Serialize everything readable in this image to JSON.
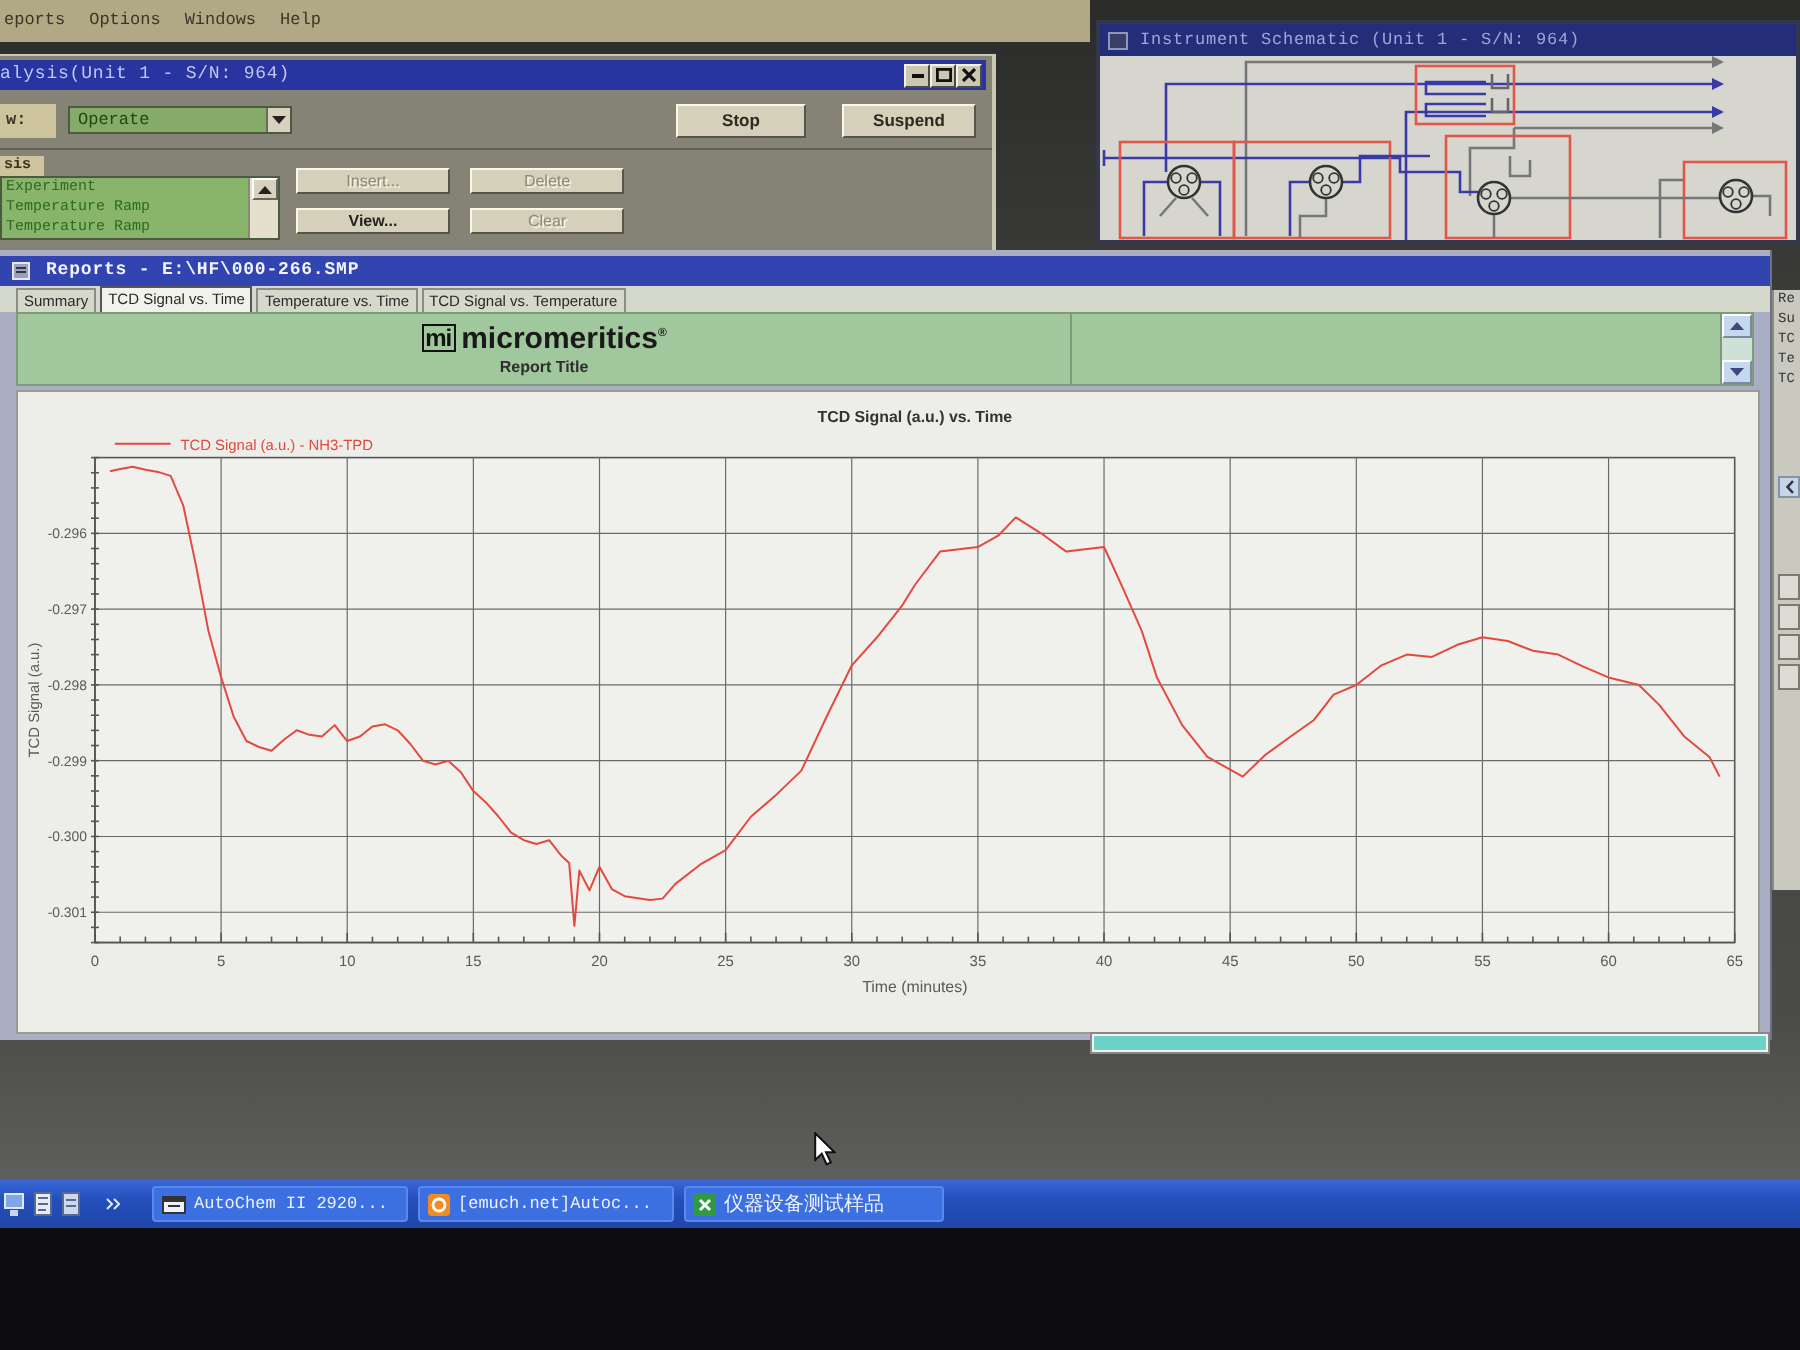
{
  "menu_bar": {
    "items": [
      "eports",
      "Options",
      "Windows",
      "Help"
    ]
  },
  "analysis_window": {
    "title": "alysis(Unit 1 - S/N: 964)",
    "mode": {
      "label": "w:",
      "value": "Operate"
    },
    "buttons": [
      {
        "label": "Stop"
      },
      {
        "label": "Suspend"
      }
    ],
    "steps": {
      "label": "sis",
      "items": [
        "Experiment",
        "Temperature Ramp",
        "Temperature Ramp"
      ]
    },
    "step_buttons": [
      {
        "label": "Insert...",
        "disabled": true
      },
      {
        "label": "Delete",
        "disabled": true
      },
      {
        "label": "View...",
        "disabled": false
      },
      {
        "label": "Clear",
        "disabled": true
      }
    ]
  },
  "schematic_window": {
    "title": "Instrument Schematic (Unit 1 - S/N: 964)"
  },
  "reports_window": {
    "title": "Reports - E:\\HF\\000-266.SMP",
    "tabs": [
      {
        "label": "Summary",
        "selected": false
      },
      {
        "label": "TCD Signal vs. Time",
        "selected": true
      },
      {
        "label": "Temperature vs. Time",
        "selected": false
      },
      {
        "label": "TCD Signal vs. Temperature",
        "selected": false
      }
    ],
    "header": {
      "logo_mark": "mi",
      "logo_text": "micromeritics$^{®}$",
      "report_title": "Report Title"
    },
    "chart_data": {
      "type": "line",
      "title": "TCD Signal (a.u.) vs. Time",
      "xlabel": "Time (minutes)",
      "ylabel": "TCD Signal (a.u.)",
      "grid": true,
      "xlim": [
        0,
        65
      ],
      "ylim": [
        -0.3014,
        -0.295
      ],
      "xticks": [
        0,
        5,
        10,
        15,
        20,
        25,
        30,
        35,
        40,
        45,
        50,
        55,
        60,
        65
      ],
      "yticks": [
        {
          "value": -0.296,
          "label": "-0.296"
        },
        {
          "value": -0.297,
          "label": "-0.297"
        },
        {
          "value": -0.298,
          "label": "-0.298"
        },
        {
          "value": -0.299,
          "label": "-0.299"
        },
        {
          "value": -0.3,
          "label": "-0.300"
        },
        {
          "value": -0.301,
          "label": "-0.301"
        }
      ],
      "x": [
        0.6,
        1,
        1.5,
        2,
        2.5,
        3,
        3.5,
        4,
        4.5,
        5,
        5.5,
        6,
        6.5,
        7,
        7.5,
        8,
        8.5,
        9,
        9.5,
        10,
        10.5,
        11,
        11.5,
        12,
        12.5,
        13,
        13.5,
        14,
        14.5,
        15,
        15.5,
        16,
        16.5,
        17,
        17.5,
        18,
        18.5,
        18.8,
        19,
        19.2,
        19.6,
        20,
        20.5,
        21,
        22,
        22.5,
        23,
        24,
        25,
        26,
        27,
        28,
        29,
        30,
        31,
        32,
        32.5,
        33.5,
        35,
        35.8,
        36.5,
        37.5,
        38.5,
        40,
        40.8,
        41.5,
        42.1,
        43.1,
        44.1,
        45.5,
        46.4,
        47.4,
        48.3,
        49.1,
        50,
        51,
        52,
        53,
        54,
        55,
        56,
        57,
        58,
        59,
        60,
        61.2,
        62,
        63,
        64,
        64.4
      ],
      "series": [
        {
          "name": "TCD Signal (a.u.) - NH3-TPD",
          "color": "#e4493e",
          "values": [
            -0.29518,
            -0.29515,
            -0.29512,
            -0.29516,
            -0.29519,
            -0.29524,
            -0.29563,
            -0.29642,
            -0.29729,
            -0.2979,
            -0.29842,
            -0.29874,
            -0.29882,
            -0.29887,
            -0.29872,
            -0.2986,
            -0.29866,
            -0.29868,
            -0.29853,
            -0.29874,
            -0.29868,
            -0.29855,
            -0.29852,
            -0.2986,
            -0.29878,
            -0.299,
            -0.29905,
            -0.299,
            -0.29915,
            -0.2994,
            -0.29955,
            -0.29974,
            -0.29995,
            -0.30005,
            -0.3001,
            -0.30005,
            -0.30026,
            -0.30035,
            -0.30118,
            -0.30045,
            -0.30071,
            -0.3004,
            -0.3007,
            -0.30079,
            -0.30084,
            -0.30082,
            -0.30063,
            -0.30037,
            -0.30018,
            -0.29974,
            -0.29945,
            -0.29913,
            -0.29842,
            -0.29774,
            -0.29737,
            -0.29695,
            -0.29668,
            -0.29624,
            -0.29618,
            -0.29603,
            -0.29579,
            -0.296,
            -0.29624,
            -0.29618,
            -0.29676,
            -0.29729,
            -0.2979,
            -0.29853,
            -0.29895,
            -0.29921,
            -0.29892,
            -0.29868,
            -0.29847,
            -0.29813,
            -0.298,
            -0.29774,
            -0.2976,
            -0.29763,
            -0.29747,
            -0.29737,
            -0.29742,
            -0.29755,
            -0.2976,
            -0.29776,
            -0.2979,
            -0.298,
            -0.29826,
            -0.29868,
            -0.29895,
            -0.29921
          ]
        }
      ]
    }
  },
  "side_window": {
    "title": "Re",
    "items": [
      "Su",
      "TC",
      "Te",
      "TC"
    ]
  },
  "progress_bar": {
    "level": 1
  },
  "taskbar": {
    "tasks": [
      {
        "kind": "app",
        "label": "AutoChem II 2920..."
      },
      {
        "kind": "browser",
        "label": "[emuch.net]Autoc..."
      },
      {
        "kind": "spreadsheet",
        "label": "仪器设备测试样品"
      }
    ]
  }
}
